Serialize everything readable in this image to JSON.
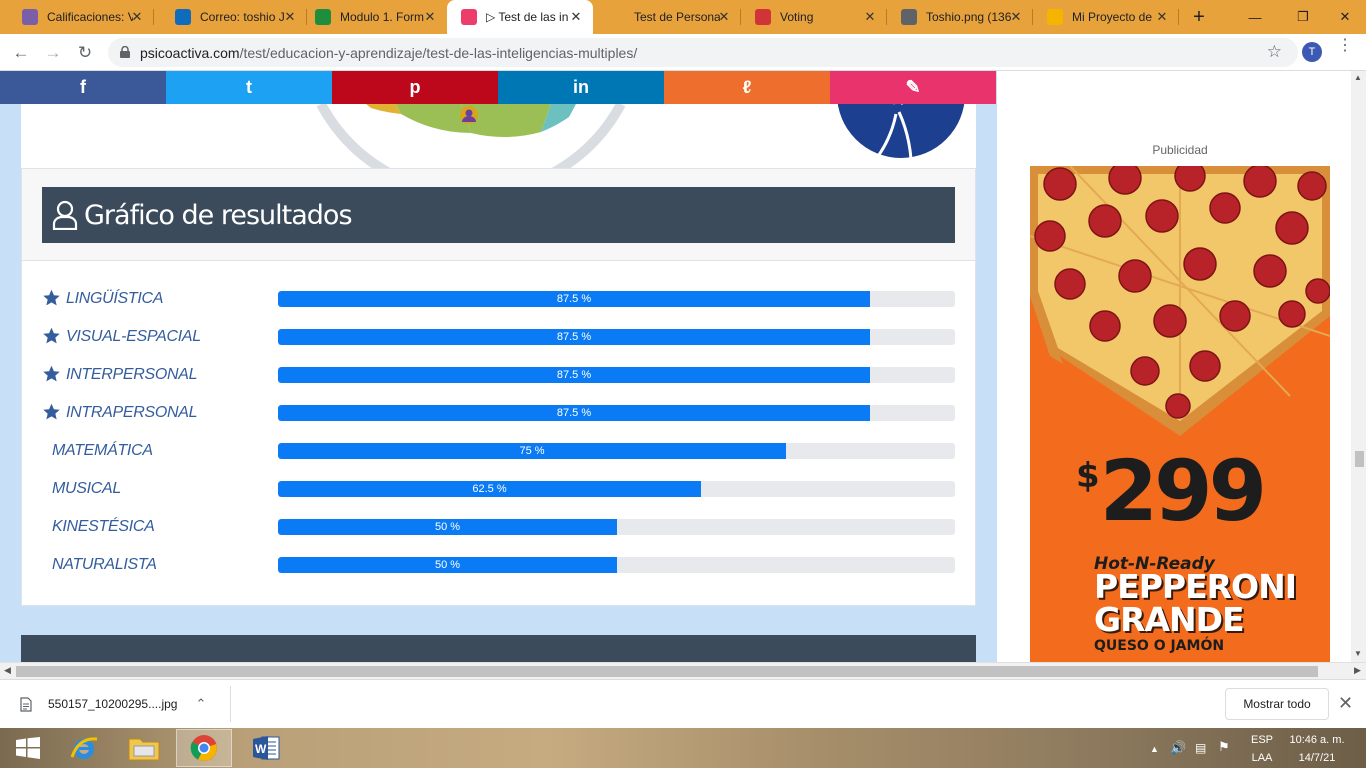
{
  "browser": {
    "tabs": [
      {
        "title": "Calificaciones: V",
        "favicon_color": "#7a5fa8"
      },
      {
        "title": "Correo: toshio J",
        "favicon_color": "#0f6cbd"
      },
      {
        "title": "Modulo 1. Form",
        "favicon_color": "#1e8e3e"
      },
      {
        "title": "▷ Test de las in",
        "favicon_color": "#ec3d6b"
      },
      {
        "title": "Test de Persona",
        "favicon_color": "#e8a23b"
      },
      {
        "title": "Voting",
        "favicon_color": "#d13438"
      },
      {
        "title": "Toshio.png (136",
        "favicon_color": "#5f6368"
      },
      {
        "title": "Mi Proyecto de",
        "favicon_color": "#f4b400"
      }
    ],
    "active_tab_index": 3,
    "url_domain": "psicoactiva.com",
    "url_path": "/test/educacion-y-aprendizaje/test-de-las-inteligencias-multiples/",
    "avatar_letter": "T"
  },
  "share": [
    {
      "network": "facebook",
      "glyph": "f",
      "color": "#3b5998"
    },
    {
      "network": "twitter",
      "glyph": "t",
      "color": "#1da1f2"
    },
    {
      "network": "pinterest",
      "glyph": "p",
      "color": "#bd081c"
    },
    {
      "network": "linkedin",
      "glyph": "in",
      "color": "#0077b5"
    },
    {
      "network": "mix",
      "glyph": "ℓ",
      "color": "#ee6f2d"
    },
    {
      "network": "whatsapp-like",
      "glyph": "✎",
      "color": "#e8336d"
    }
  ],
  "results": {
    "title": "Gráfico de resultados",
    "rows": [
      {
        "label": "LINGÜÍSTICA",
        "value_text": "87.5 %",
        "value": 87.5,
        "starred": true
      },
      {
        "label": "VISUAL-ESPACIAL",
        "value_text": "87.5 %",
        "value": 87.5,
        "starred": true
      },
      {
        "label": "INTERPERSONAL",
        "value_text": "87.5 %",
        "value": 87.5,
        "starred": true
      },
      {
        "label": "INTRAPERSONAL",
        "value_text": "87.5 %",
        "value": 87.5,
        "starred": true
      },
      {
        "label": "MATEMÁTICA",
        "value_text": "75 %",
        "value": 75,
        "starred": false
      },
      {
        "label": "MUSICAL",
        "value_text": "62.5 %",
        "value": 62.5,
        "starred": false
      },
      {
        "label": "KINESTÉSICA",
        "value_text": "50 %",
        "value": 50,
        "starred": false
      },
      {
        "label": "NATURALISTA",
        "value_text": "50 %",
        "value": 50,
        "starred": false
      }
    ]
  },
  "ad": {
    "caption": "Publicidad",
    "price_symbol": "$",
    "price": "299",
    "tagline": "Hot-N-Ready",
    "product_line1": "PEPPERONI",
    "product_line2": "GRANDE",
    "subline": "QUESO O JAMÓN"
  },
  "downloads": {
    "file": "550157_10200295....jpg",
    "show_all": "Mostrar todo"
  },
  "tray": {
    "lang": "ESP",
    "layout": "LAA",
    "time": "10:46 a. m.",
    "date": "14/7/21"
  }
}
